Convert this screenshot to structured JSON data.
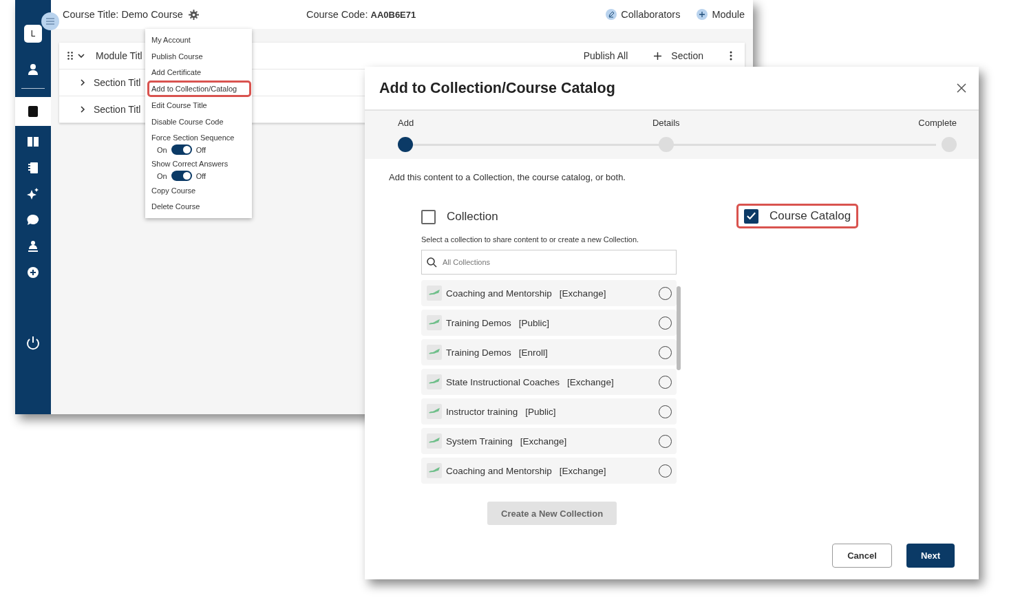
{
  "app": {
    "course_title": "Course Title: Demo Course",
    "course_code_label": "Course Code:",
    "course_code": "AA0B6E71",
    "actions": [
      {
        "kind": "edit",
        "label": "Collaborators"
      },
      {
        "kind": "add",
        "label": "Module"
      }
    ],
    "avatar": "L",
    "sidebar_items": [
      {
        "selected": false
      },
      {
        "selected": true
      },
      {
        "selected": false
      },
      {
        "selected": false
      },
      {
        "selected": false
      },
      {
        "selected": false
      },
      {
        "selected": false
      },
      {
        "selected": false
      }
    ],
    "module": {
      "title": "Module Titl",
      "expanded": true,
      "publish": "Publish All",
      "add_section": "Section",
      "sections": [
        {
          "title": "Section Titl",
          "expanded": false
        },
        {
          "title": "Section Titl",
          "expanded": false
        }
      ]
    }
  },
  "menu": {
    "items": [
      {
        "kind": "item",
        "label": "My Account",
        "highlighted": false
      },
      {
        "kind": "item",
        "label": "Publish Course",
        "highlighted": false
      },
      {
        "kind": "item",
        "label": "Add Certificate",
        "highlighted": false
      },
      {
        "kind": "item",
        "label": "Add to Collection/Catalog",
        "highlighted": true
      },
      {
        "kind": "item",
        "label": "Edit Course Title",
        "highlighted": false
      },
      {
        "kind": "item",
        "label": "Disable Course Code",
        "highlighted": false
      },
      {
        "kind": "toggle",
        "label": "Force Section Sequence",
        "on_label": "On",
        "off_label": "Off",
        "on": true
      },
      {
        "kind": "toggle",
        "label": "Show Correct Answers",
        "on_label": "On",
        "off_label": "Off",
        "on": true
      },
      {
        "kind": "item",
        "label": "Copy Course",
        "highlighted": false
      },
      {
        "kind": "item",
        "label": "Delete Course",
        "highlighted": false
      }
    ]
  },
  "dialog": {
    "title": "Add to Collection/Course Catalog",
    "steps": [
      {
        "label": "Add",
        "selected": true
      },
      {
        "label": "Details",
        "selected": false
      },
      {
        "label": "Complete",
        "selected": false
      }
    ],
    "intro": "Add this content to a Collection, the course catalog, or both.",
    "options": [
      {
        "label": "Collection",
        "checked": false,
        "highlighted": false
      },
      {
        "label": "Course Catalog",
        "checked": true,
        "highlighted": true
      }
    ],
    "collection_hint": "Select a collection to share content to or create a new Collection.",
    "search": {
      "placeholder": "All Collections"
    },
    "collections": [
      {
        "name": "Coaching and Mentorship",
        "tag": "[Exchange]",
        "selected": false
      },
      {
        "name": "Training Demos",
        "tag": "[Public]",
        "selected": false
      },
      {
        "name": "Training Demos",
        "tag": "[Enroll]",
        "selected": false
      },
      {
        "name": "State Instructional Coaches",
        "tag": "[Exchange]",
        "selected": false
      },
      {
        "name": "Instructor training",
        "tag": "[Public]",
        "selected": false
      },
      {
        "name": "System Training",
        "tag": "[Exchange]",
        "selected": false
      },
      {
        "name": "Coaching and Mentorship",
        "tag": "[Exchange]",
        "selected": false
      }
    ],
    "create_button": {
      "label": "Create a New Collection",
      "disabled": true
    },
    "cancel": "Cancel",
    "next": "Next"
  }
}
